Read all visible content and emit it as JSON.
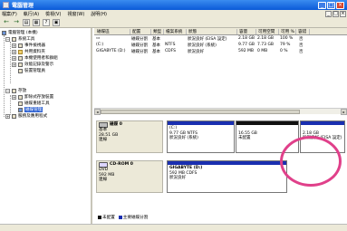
{
  "window": {
    "title": "電腦管理",
    "controls": [
      "_",
      "□",
      "×"
    ]
  },
  "menu": {
    "items": [
      "檔案(F)",
      "執行(A)",
      "檢視(V)",
      "視窗(W)",
      "說明(H)"
    ],
    "mdi": [
      "_",
      "□",
      "×"
    ]
  },
  "toolbar": {
    "buttons": [
      "←",
      "→",
      "▤",
      "▦",
      "?",
      "▣"
    ]
  },
  "tree": {
    "root": "電腦管理 (本機)",
    "system_tools": "系統工具",
    "items": [
      "事件檢視器",
      "共用資料夾",
      "本機使用者和群組",
      "效能記錄及警示",
      "裝置管理員"
    ],
    "storage": "存放",
    "storage_items": [
      "卸除式存放裝置",
      "磁碟重組工具",
      "磁碟管理"
    ],
    "services": "服務及應用程式"
  },
  "table": {
    "columns": [
      "磁碟區",
      "配置",
      "類型",
      "檔案系統",
      "狀態",
      "容量",
      "可用空間",
      "可用 %",
      "容錯"
    ],
    "rows": [
      [
        "",
        "磁碟分割",
        "基本",
        "",
        "狀況良好 (EISA 設定)",
        "2.18 GB",
        "2.18 GB",
        "100 %",
        "否"
      ],
      [
        "(C:)",
        "磁碟分割",
        "基本",
        "NTFS",
        "狀況良好 (系統)",
        "9.77 GB",
        "7.73 GB",
        "79 %",
        "否"
      ],
      [
        "GIGABYTE (D:)",
        "磁碟分割",
        "基本",
        "CDFS",
        "狀況良好",
        "592 MB",
        "0 MB",
        "0 %",
        "否"
      ]
    ]
  },
  "disks": [
    {
      "name": "磁碟 0",
      "type": "基本",
      "size": "28.51 GB",
      "status": "連線",
      "partitions": [
        {
          "name": "(C:)",
          "detail": "9.77 GB NTFS",
          "status": "狀況良好 (系統)"
        },
        {
          "name": "",
          "detail": "16.55 GB",
          "status": "未配置"
        },
        {
          "name": "",
          "detail": "2.18 GB",
          "status": "狀況良好 (EISA 設定)"
        }
      ]
    },
    {
      "name": "CD-ROM 0",
      "type": "DVD",
      "size": "592 MB",
      "status": "連線",
      "partitions": [
        {
          "name": "GIGABYTE (D:)",
          "detail": "592 MB CDFS",
          "status": "狀況良好"
        }
      ]
    }
  ],
  "legend": {
    "unallocated": "未配置",
    "primary": "主要磁碟分割"
  },
  "colors": {
    "primary": "#1a2fb0",
    "unallocated": "#111111",
    "highlight": "#e0408a"
  }
}
